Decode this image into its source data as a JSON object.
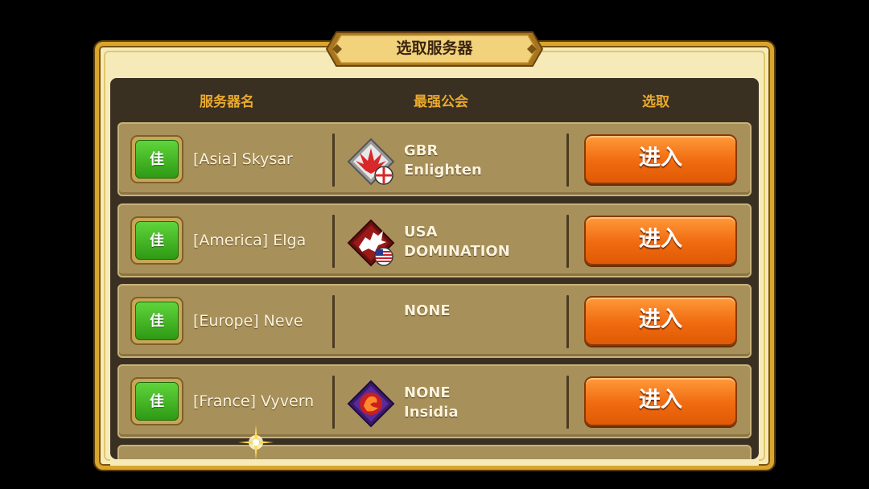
{
  "dialog": {
    "title": "选取服务器",
    "columns": {
      "server_name": "服务器名",
      "top_guild": "最强公会",
      "select": "选取"
    }
  },
  "servers": [
    {
      "status": "佳",
      "name": "[Asia] Skysar",
      "guild_line1": "GBR",
      "guild_line2": "Enlighten",
      "emblem": "phoenix-wings-emblem",
      "flag": "england-flag",
      "button": "进入"
    },
    {
      "status": "佳",
      "name": "[America] Elga",
      "guild_line1": "USA",
      "guild_line2": "DOMINATION",
      "emblem": "griffin-emblem",
      "flag": "usa-flag",
      "button": "进入"
    },
    {
      "status": "佳",
      "name": "[Europe] Neve",
      "guild_line1": "NONE",
      "guild_line2": "",
      "emblem": "",
      "flag": "",
      "button": "进入"
    },
    {
      "status": "佳",
      "name": "[France] Vyvern",
      "guild_line1": "NONE",
      "guild_line2": "Insidia",
      "emblem": "purple-phoenix-emblem",
      "flag": "",
      "button": "进入"
    }
  ],
  "colors": {
    "accent_gold": "#e8a92e",
    "frame_gold": "#d9a52c",
    "enter_orange": "#f06a10",
    "status_green": "#3fb520"
  }
}
